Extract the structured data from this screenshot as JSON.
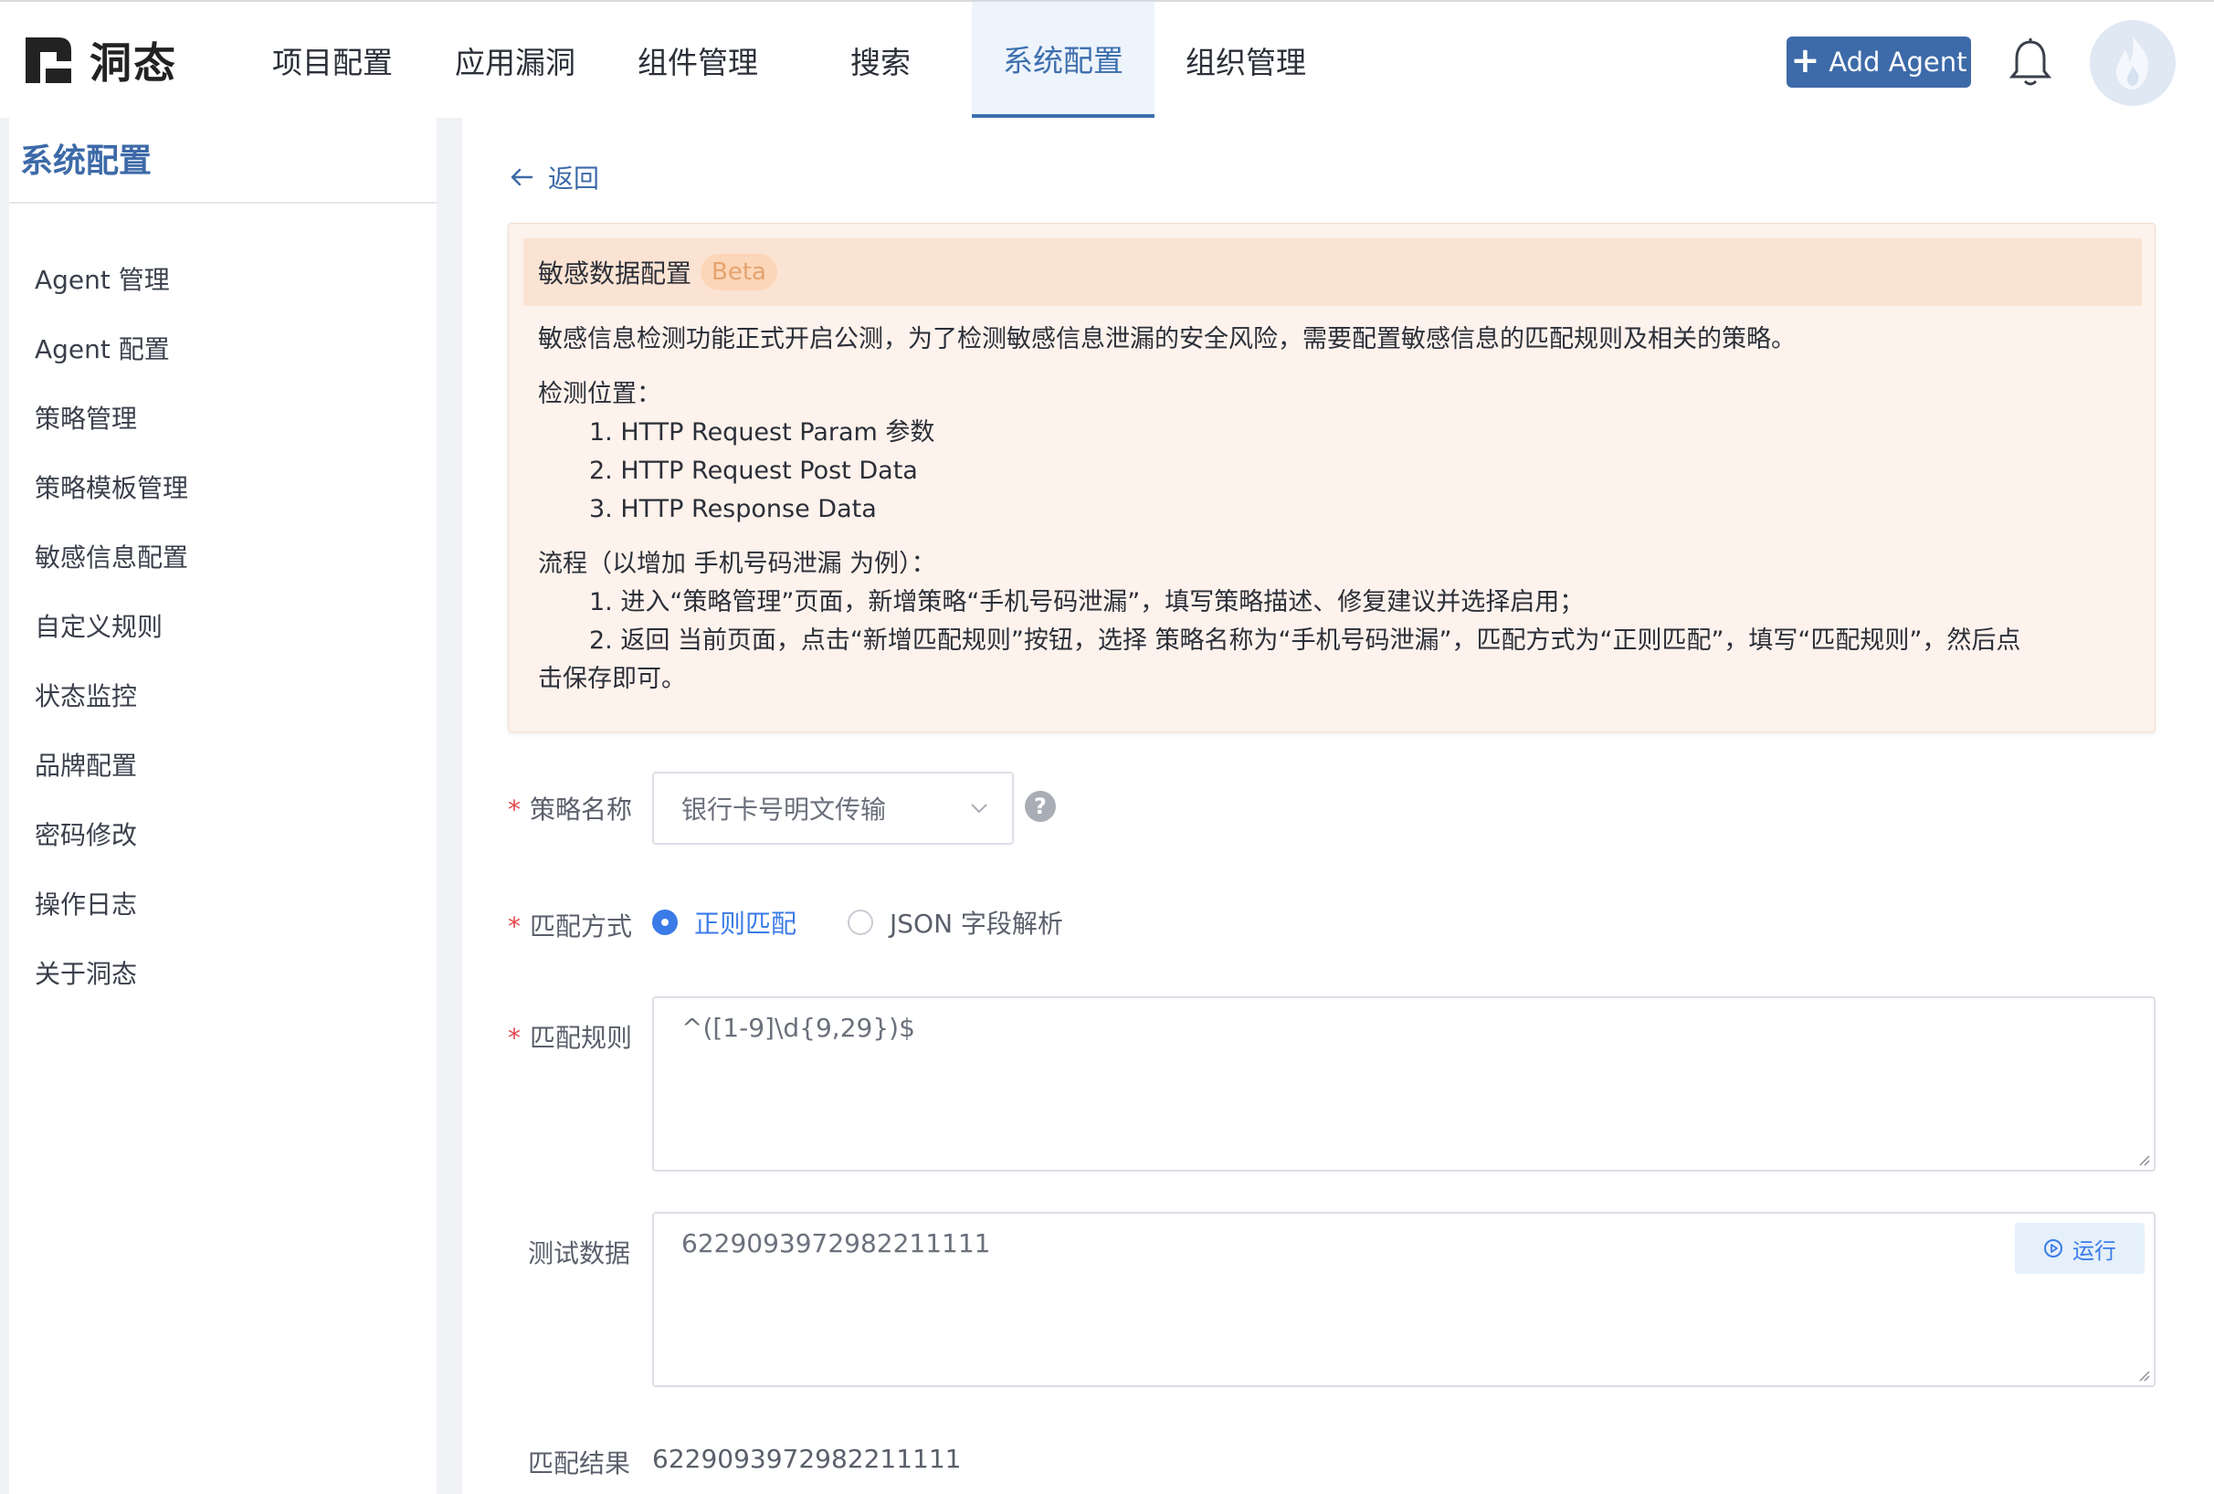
{
  "brand": {
    "name": "洞态"
  },
  "nav": {
    "items": [
      {
        "label": "项目配置",
        "active": false
      },
      {
        "label": "应用漏洞",
        "active": false
      },
      {
        "label": "组件管理",
        "active": false
      },
      {
        "label": "搜索",
        "active": false
      },
      {
        "label": "系统配置",
        "active": true
      },
      {
        "label": "组织管理",
        "active": false
      }
    ],
    "add_agent_label": "Add Agent",
    "bell_icon": "bell-icon",
    "avatar_icon": "flame-avatar"
  },
  "sidebar": {
    "title": "系统配置",
    "items": [
      {
        "label": "Agent 管理"
      },
      {
        "label": "Agent 配置"
      },
      {
        "label": "策略管理"
      },
      {
        "label": "策略模板管理"
      },
      {
        "label": "敏感信息配置"
      },
      {
        "label": "自定义规则"
      },
      {
        "label": "状态监控"
      },
      {
        "label": "品牌配置"
      },
      {
        "label": "密码修改"
      },
      {
        "label": "操作日志"
      },
      {
        "label": "关于洞态"
      }
    ]
  },
  "main": {
    "back_label": "返回",
    "notice": {
      "title": "敏感数据配置",
      "badge": "Beta",
      "intro": "敏感信息检测功能正式开启公测，为了检测敏感信息泄漏的安全风险，需要配置敏感信息的匹配规则及相关的策略。",
      "locations_title": "检测位置：",
      "locations": [
        "1. HTTP Request Param 参数",
        "2. HTTP Request Post Data",
        "3. HTTP Response Data"
      ],
      "flow_title": "流程（以增加 手机号码泄漏 为例）：",
      "flow_steps": [
        "1. 进入“策略管理”页面，新增策略“手机号码泄漏”，填写策略描述、修复建议并选择启用；",
        "2. 返回 当前页面，点击“新增匹配规则”按钮，选择 策略名称为“手机号码泄漏”，匹配方式为“正则匹配”，填写“匹配规则”，然后点"
      ],
      "flow_tail": "击保存即可。"
    },
    "form": {
      "policy_name_label": "策略名称",
      "policy_name_value": "银行卡号明文传输",
      "match_type_label": "匹配方式",
      "match_options": [
        {
          "label": "正则匹配",
          "selected": true
        },
        {
          "label": "JSON 字段解析",
          "selected": false
        }
      ],
      "match_rule_label": "匹配规则",
      "match_rule_value": "^([1-9]\\d{9,29})$",
      "test_data_label": "测试数据",
      "test_data_value": "6229093972982211111",
      "run_label": "运行",
      "result_label": "匹配结果",
      "result_value": "6229093972982211111"
    }
  },
  "colors": {
    "accent": "#3d6aa8",
    "radio_active": "#3b7be8",
    "notice_bg": "#fdf2ec",
    "notice_header_bg": "#fbe3d3",
    "required": "#e5484d"
  }
}
